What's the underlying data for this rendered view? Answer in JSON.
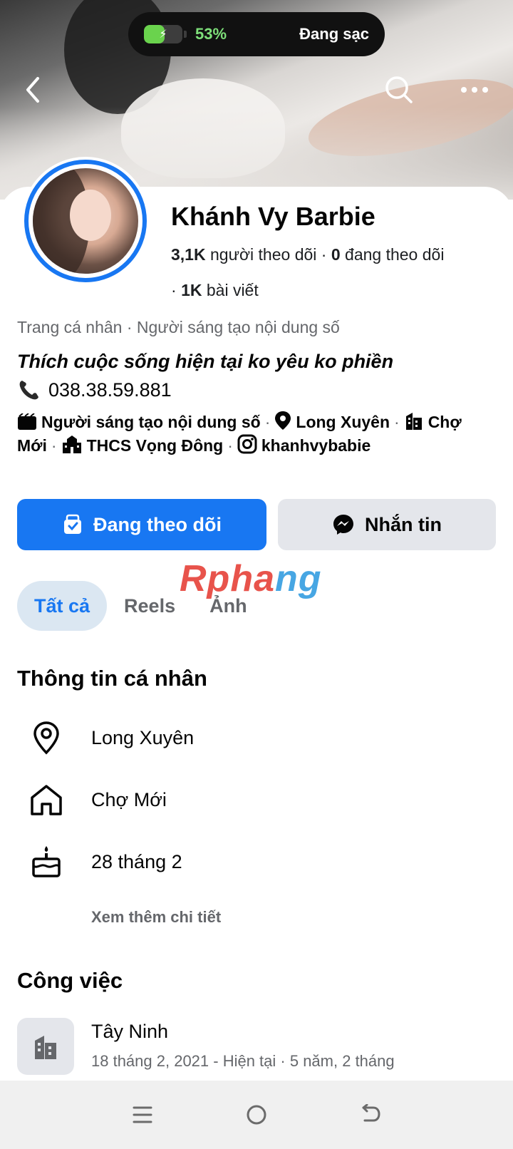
{
  "status": {
    "battery_percent": 53,
    "battery_label": "53%",
    "charging_label": "Đang sạc"
  },
  "profile": {
    "name": "Khánh Vy Barbie",
    "followers_count": "3,1K",
    "followers_label": " người theo dõi · ",
    "following_count": "0",
    "following_label": " đang theo dõi",
    "posts_prefix": "· ",
    "posts_count": "1K",
    "posts_label": " bài viết",
    "category": "Trang cá nhân · Người sáng tạo nội dung số",
    "bio": "Thích cuộc sống hiện tại ko yêu ko phiền",
    "phone": "038.38.59.881"
  },
  "intro": {
    "creator": "Người sáng tạo nội dung số",
    "location": "Long Xuyên",
    "hometown_part1": "Chợ",
    "hometown_part2": "Mới",
    "school": "THCS Vọng Đông",
    "instagram": "khanhvybabie"
  },
  "actions": {
    "follow_label": "Đang theo dõi",
    "message_label": "Nhắn tin"
  },
  "watermark": {
    "part1": "Rpha",
    "part2": "ng"
  },
  "tabs": [
    {
      "label": "Tất cả",
      "active": true
    },
    {
      "label": "Reels",
      "active": false
    },
    {
      "label": "Ảnh",
      "active": false
    }
  ],
  "personal_info": {
    "heading": "Thông tin cá nhân",
    "items": [
      {
        "icon": "location-pin-icon",
        "text": "Long Xuyên"
      },
      {
        "icon": "home-icon",
        "text": "Chợ Mới"
      },
      {
        "icon": "birthday-cake-icon",
        "text": "28 tháng 2"
      }
    ],
    "see_more": "Xem thêm chi tiết"
  },
  "work": {
    "heading": "Công việc",
    "title": "Tây Ninh",
    "subtitle": "18 tháng 2, 2021 - Hiện tại · 5 năm, 2 tháng"
  },
  "colors": {
    "primary": "#1877f2",
    "secondary_button": "#e4e6eb",
    "muted_text": "#65676b",
    "active_tab_bg": "#dbe7f2"
  }
}
